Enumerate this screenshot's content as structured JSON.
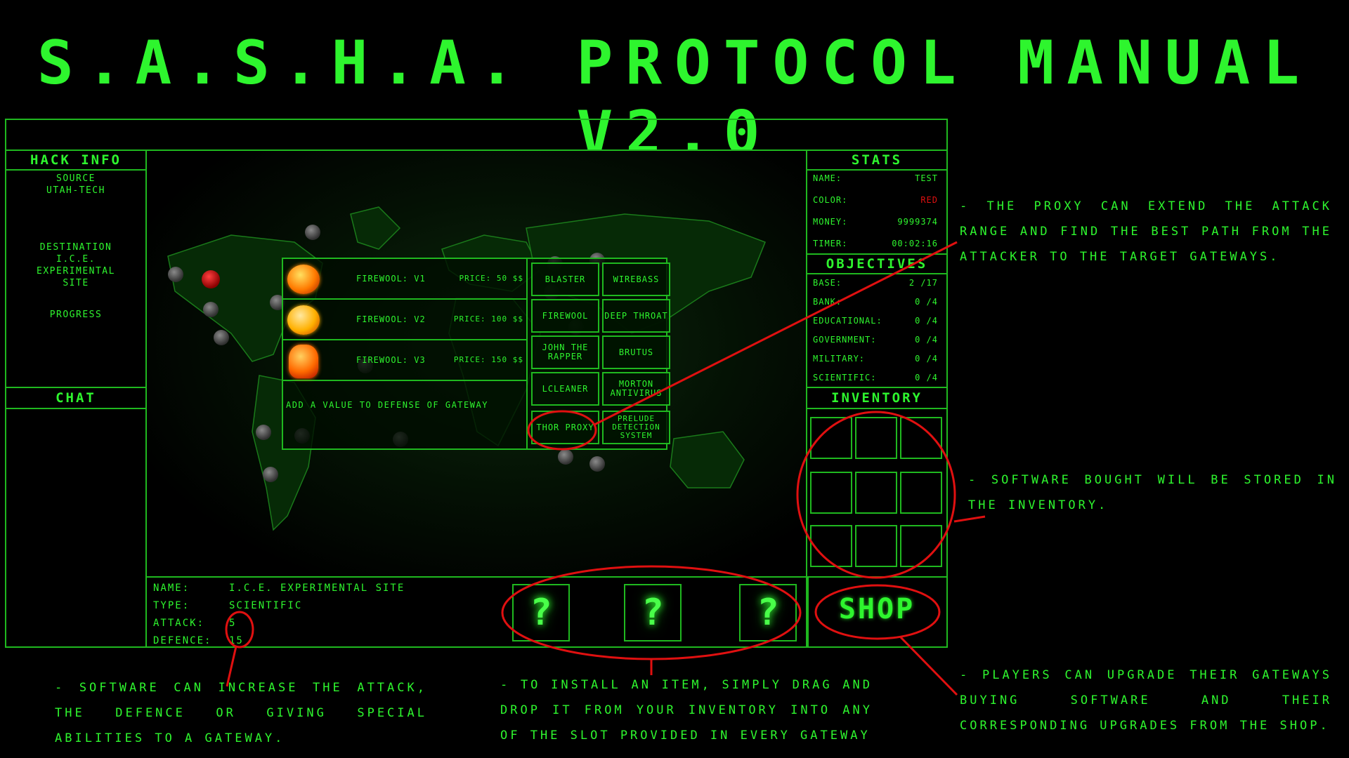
{
  "title": "S.A.S.H.A. PROTOCOL MANUAL V2.0",
  "hack_info": {
    "header": "HACK INFO",
    "source_label": "SOURCE",
    "source_value": "UTAH-TECH",
    "destination_label": "DESTINATION",
    "destination_value_1": "I.C.E.",
    "destination_value_2": "EXPERIMENTAL",
    "destination_value_3": "SITE",
    "progress_label": "PROGRESS"
  },
  "chat": {
    "header": "CHAT"
  },
  "stats": {
    "header": "STATS",
    "rows": [
      {
        "label": "NAME:",
        "value": "TEST"
      },
      {
        "label": "COLOR:",
        "value": "RED"
      },
      {
        "label": "MONEY:",
        "value": "9999374"
      },
      {
        "label": "TIMER:",
        "value": "00:02:16"
      }
    ]
  },
  "objectives": {
    "header": "OBJECTIVES",
    "rows": [
      {
        "label": "BASE:",
        "value": "2 /17"
      },
      {
        "label": "BANK:",
        "value": "0 /4"
      },
      {
        "label": "EDUCATIONAL:",
        "value": "0 /4"
      },
      {
        "label": "GOVERNMENT:",
        "value": "0 /4"
      },
      {
        "label": "MILITARY:",
        "value": "0 /4"
      },
      {
        "label": "SCIENTIFIC:",
        "value": "0 /4"
      }
    ]
  },
  "inventory": {
    "header": "INVENTORY"
  },
  "shop_button": "SHOP",
  "shop": {
    "firewool": [
      {
        "name": "FIREWOOL: V1",
        "price": "PRICE: 50 $$"
      },
      {
        "name": "FIREWOOL: V2",
        "price": "PRICE: 100 $$"
      },
      {
        "name": "FIREWOOL: V3",
        "price": "PRICE: 150 $$"
      }
    ],
    "description": "ADD A VALUE TO DEFENSE OF GATEWAY",
    "items": [
      "BLASTER",
      "WIREBASS",
      "FIREWOOL",
      "DEEP THROAT",
      "JOHN THE RAPPER",
      "BRUTUS",
      "LCLEANER",
      "MORTON ANTIVIRUS",
      "THOR PROXY",
      "PRELUDE DETECTION SYSTEM"
    ]
  },
  "gateway": {
    "name_label": "NAME:",
    "name_value": "I.C.E. EXPERIMENTAL SITE",
    "type_label": "TYPE:",
    "type_value": "SCIENTIFIC",
    "attack_label": "ATTACK:",
    "attack_value": "5",
    "defence_label": "DEFENCE:",
    "defence_value": "15",
    "slot_glyph": "?"
  },
  "notes": {
    "proxy": "- THE PROXY CAN EXTEND THE ATTACK RANGE AND FIND THE BEST PATH FROM THE ATTACKER TO THE TARGET GATEWAYS.",
    "inventory": "- SOFTWARE BOUGHT WILL BE STORED IN THE INVENTORY.",
    "shop": "- PLAYERS CAN UPGRADE THEIR GATEWAYS BUYING SOFTWARE AND THEIR CORRESPONDING UPGRADES FROM THE SHOP.",
    "software": "- SOFTWARE CAN INCREASE THE ATTACK, THE DEFENCE OR GIVING SPECIAL ABILITIES TO A GATEWAY.",
    "install": "- TO INSTALL AN ITEM, SIMPLY DRAG AND DROP IT FROM YOUR INVENTORY INTO ANY OF THE SLOT PROVIDED IN EVERY GATEWAY"
  },
  "colors": {
    "green": "#2ef52e",
    "border": "#1fb81f",
    "red": "#e01010"
  }
}
